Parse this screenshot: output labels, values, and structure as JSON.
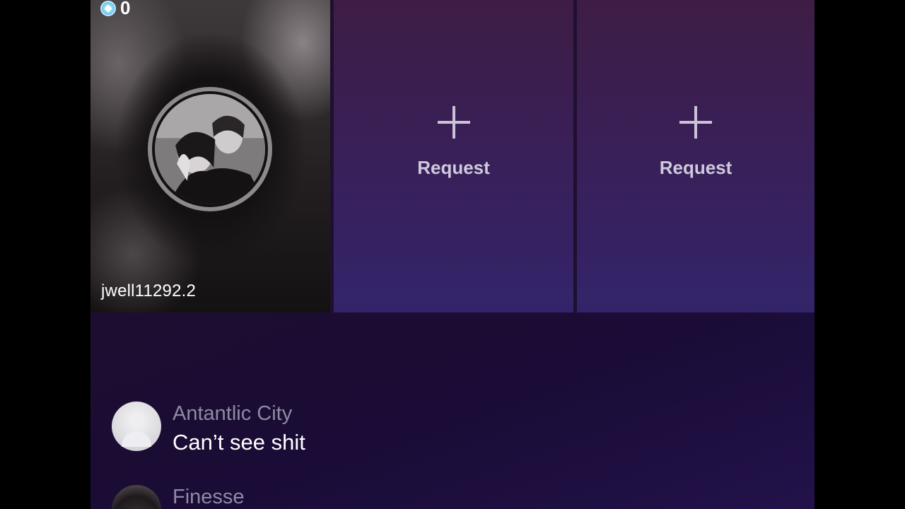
{
  "host": {
    "coin_count": "0",
    "username": "jwell11292.2",
    "coin_icon": "gem-icon",
    "avatar_icon": "avatar-photo"
  },
  "guest_slots": [
    {
      "label": "Request",
      "icon": "plus-icon"
    },
    {
      "label": "Request",
      "icon": "plus-icon"
    }
  ],
  "comments": [
    {
      "name": "Antantlic City",
      "text": "Can’t see shit",
      "avatar": "default-avatar-icon"
    },
    {
      "name": "Finesse",
      "text": "",
      "avatar": "profile-photo"
    }
  ],
  "colors": {
    "accent_coin": "#7fd1f3",
    "request_tile_top": "#3e1d44",
    "request_tile_bottom": "#33246a",
    "chat_bg": "#1a0c36",
    "comment_name": "#8e8aa3"
  }
}
